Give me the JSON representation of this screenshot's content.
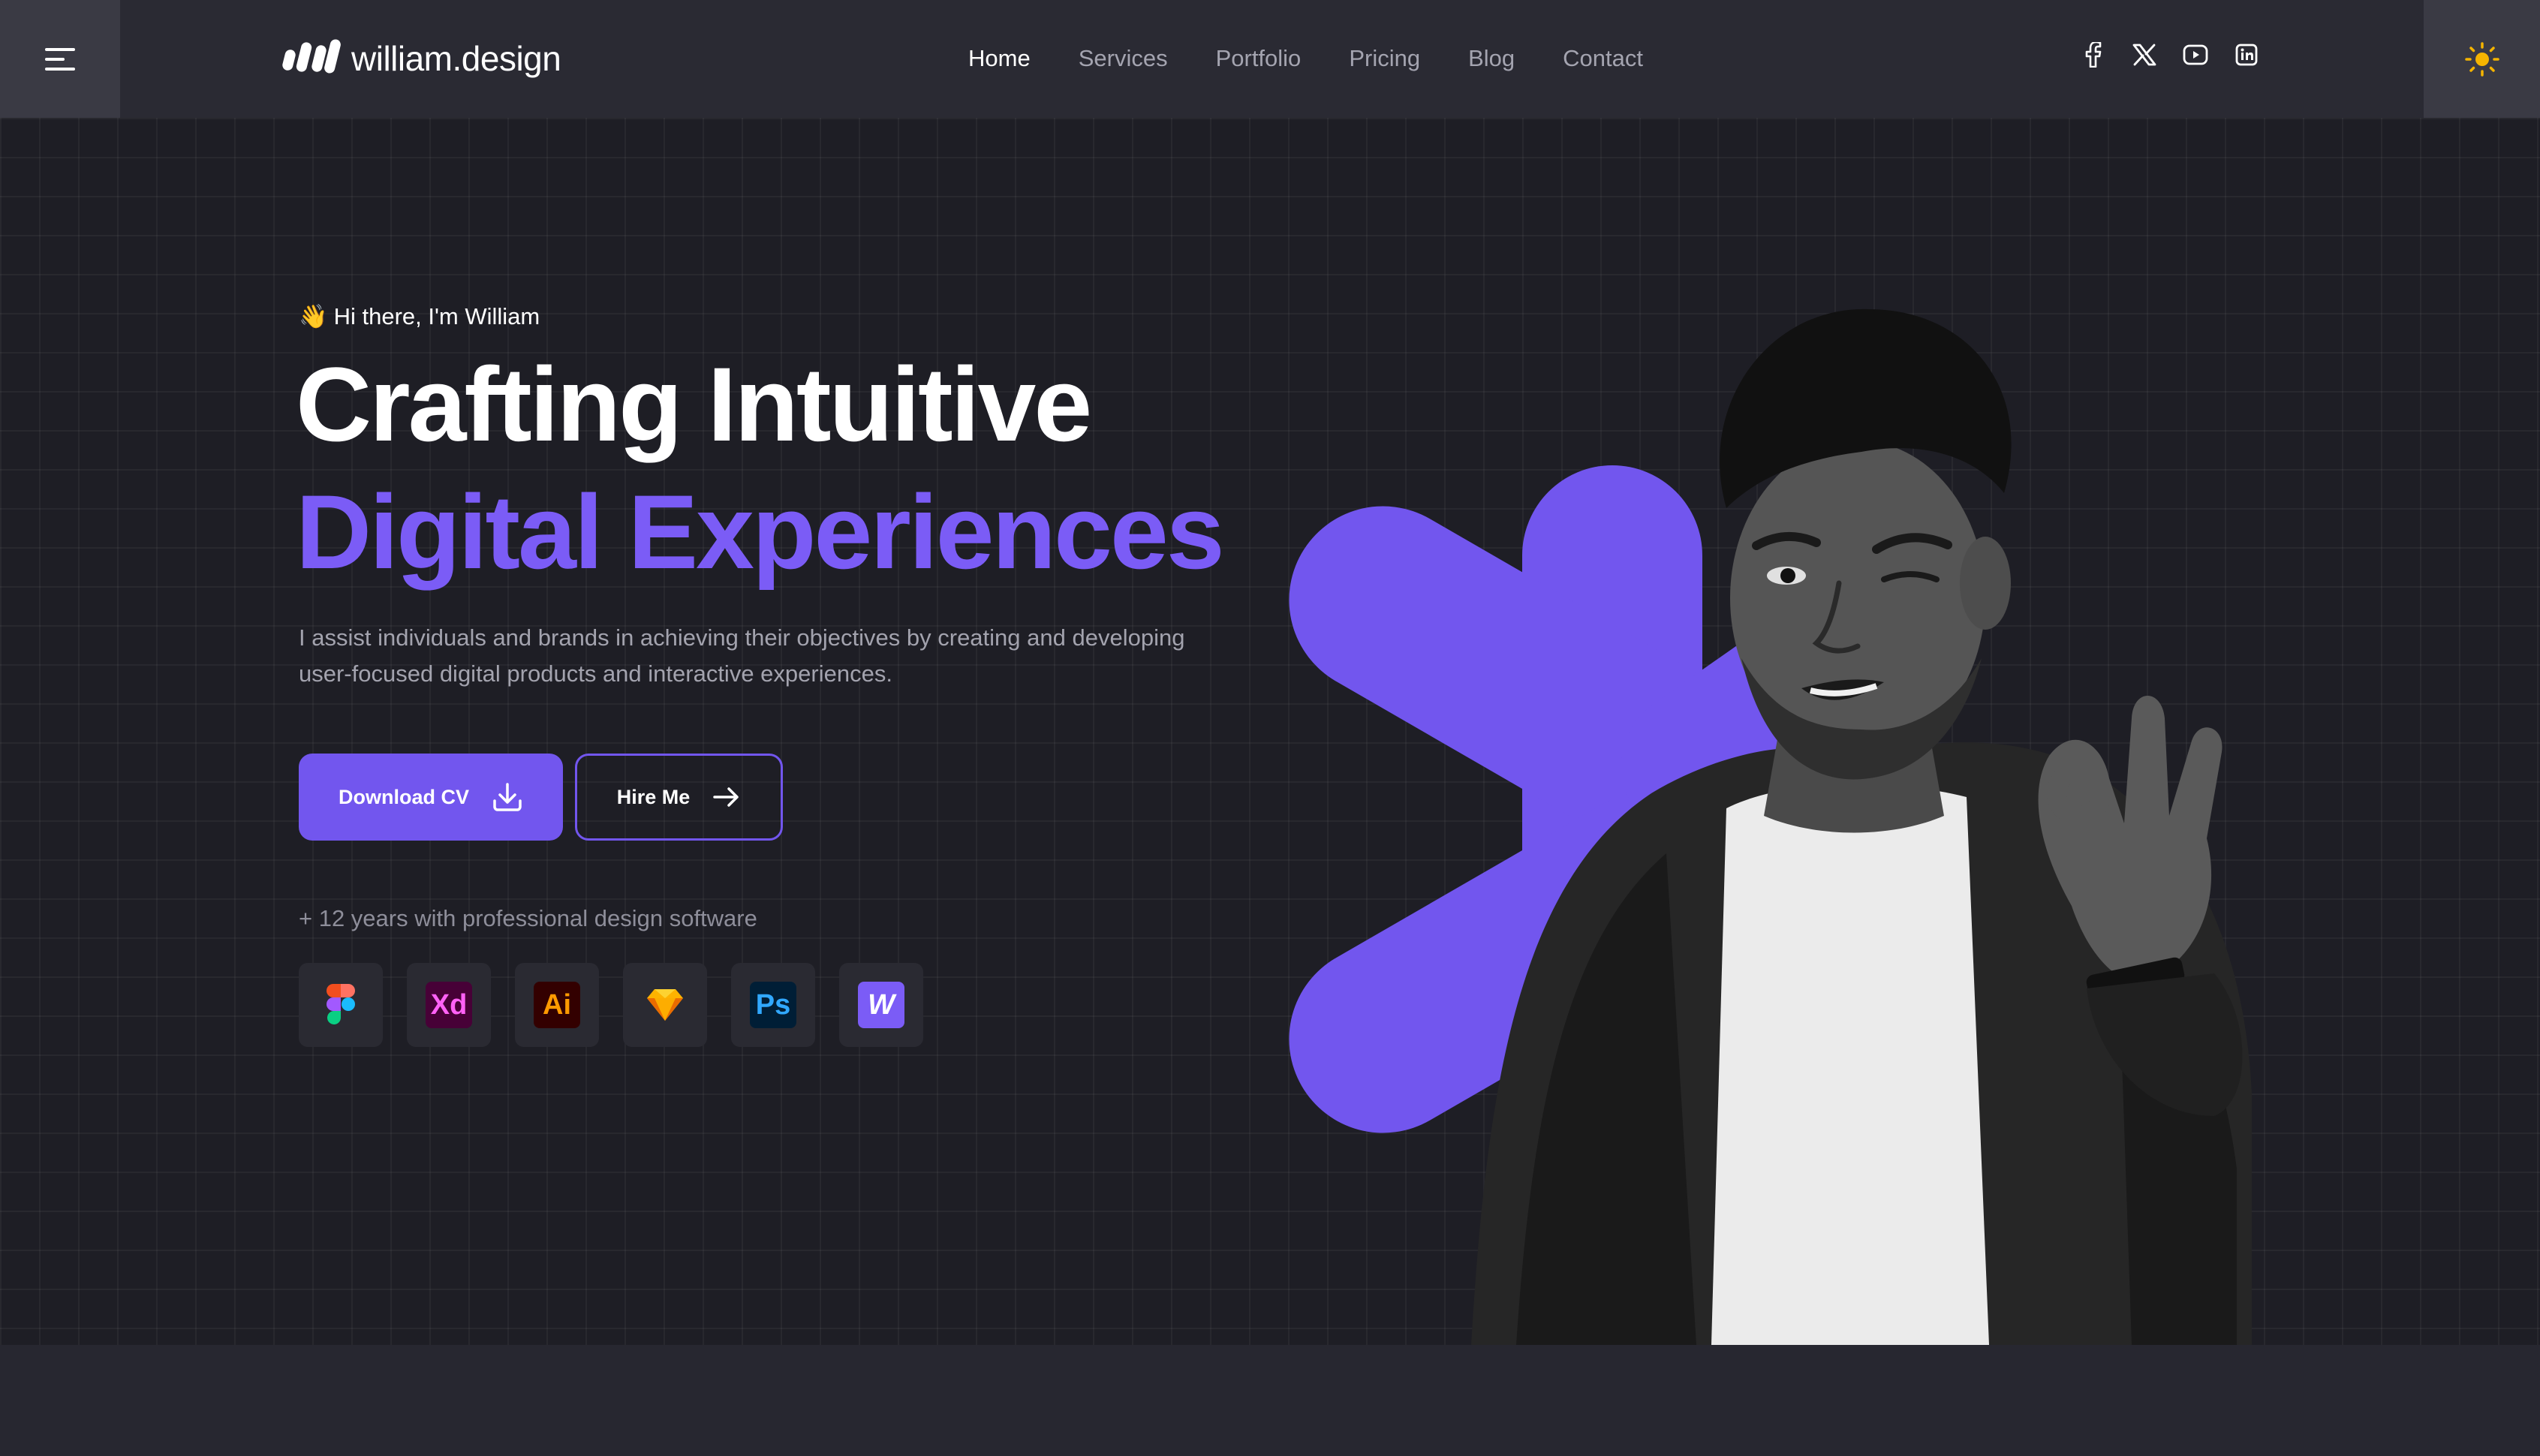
{
  "brand": {
    "name": "william.design"
  },
  "nav": {
    "items": [
      {
        "label": "Home",
        "active": true
      },
      {
        "label": "Services",
        "active": false
      },
      {
        "label": "Portfolio",
        "active": false
      },
      {
        "label": "Pricing",
        "active": false
      },
      {
        "label": "Blog",
        "active": false
      },
      {
        "label": "Contact",
        "active": false
      }
    ]
  },
  "socials": [
    "facebook-icon",
    "x-icon",
    "youtube-icon",
    "linkedin-icon"
  ],
  "hero": {
    "greeting_emoji": "👋",
    "greeting": "Hi there, I'm William",
    "title_line1": "Crafting Intuitive",
    "title_line2": "Digital Experiences",
    "description": "I assist individuals and brands in achieving their objectives by creating and developing user-focused digital products and interactive experiences.",
    "primary_button": "Download CV",
    "secondary_button": "Hire Me",
    "experience": "+ 12 years with professional design software",
    "tools": [
      {
        "name": "figma-icon",
        "label": ""
      },
      {
        "name": "adobe-xd-icon",
        "label": "Xd"
      },
      {
        "name": "adobe-illustrator-icon",
        "label": "Ai"
      },
      {
        "name": "sketch-icon",
        "label": ""
      },
      {
        "name": "photoshop-icon",
        "label": "Ps"
      },
      {
        "name": "webflow-icon",
        "label": "W"
      }
    ]
  },
  "colors": {
    "accent": "#7256ee",
    "accent_text": "#7b5cf6",
    "background": "#1e1e25",
    "header": "#2a2a33",
    "sun": "#f5b400"
  }
}
